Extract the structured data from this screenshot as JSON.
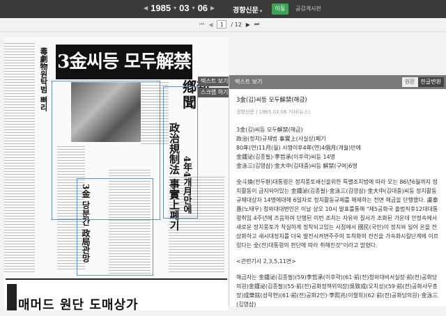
{
  "topbar": {
    "year": "1985",
    "month": "03",
    "day": "06",
    "paper": "경향신문",
    "go_label": "이동",
    "share_label": "공감게시판"
  },
  "pagebar": {
    "current_page": "1",
    "total_pages": "/ 12"
  },
  "newspaper": {
    "headline": "3金씨등 모두解禁",
    "masthead": "鄕新聞",
    "sub_headline": "政治規制法 事實上폐기",
    "sub_headline2": "4年4개月만에",
    "side_headline": "3金 당분간 政局관망",
    "left_headline": "毒劇物원탁범 뼈리",
    "ad_text": "매머드 원단 도매상가"
  },
  "sidetabs": [
    "텍스트 보기",
    "스크랩 하기"
  ],
  "panel": {
    "header": "텍스트 보기",
    "tab_original": "원문",
    "tab_hangul": "한글변환",
    "title": "3金(김)씨등 모두解禁(해금)",
    "meta": "경향신문 | 1985.03.06 기사(뉴스)",
    "lines": [
      "3金(김)씨등 모두解禁(해금)",
      "政治(정치)규제법 事實上(사실상)폐기",
      "80年(연)11月(월) 시행이후4年(연)4個月(개월)만에",
      "金鍾泌(김종필)·李哲承(이후락)씨등 14명",
      "金泳三(김영삼)·金大中(김대중)씨등 解禁(구여)6명"
    ],
    "para1": "全斗煥(전두환)대통령은 정치풍토쇄신을위한 특별조치법에 따라 오는 86년6월까지 정치활동이 금지되어있는 金鍾泌(김종필)·金泳三(김영삼)·金大中(김대중)씨등 정치활동규제대상자 14명에대해 6일자로 정치활동규제를 해제하는 전면 해금을 단행했다. 盧泰愚(노태우) 청와대대변인은 이날 상오 10시 발표를통해 \"제5공화국 출범직후12대대통령취임 4주년에 즈음하여 단행된 이번 조치는 자유와 질서가 조화된 가운데 안정속에서 새로운 정치풍토가 착실하게 정착되고있는 시점에서 國民(국민)이 정치와 일어 온을 전상화하고 새시대정치를 더욱 발전시켜면주주의 토착화의 전진을 가속화시킬단계에 이르렀다는 全(전)대통령의 판단에 따라 취해진것\"이라고 밝혔다.",
    "para2": "<관련기사 2,3,5,11면>",
    "para3": "해금자는 金鍾泌(김종필)(59)李哲承(이후락)(61·前(전)청와대비서실장·前(전)공화당의원)金鍾泌(김종필)(55·前(전)공화정책위의장)吳致成(오치성)(59·前(전)공화사무총장)成樂鉉(성락현)(61·前(전)공화2인)·李熙兆(이철희)(62·前(전)공화당의원)·金泳三(김영삼)"
  }
}
